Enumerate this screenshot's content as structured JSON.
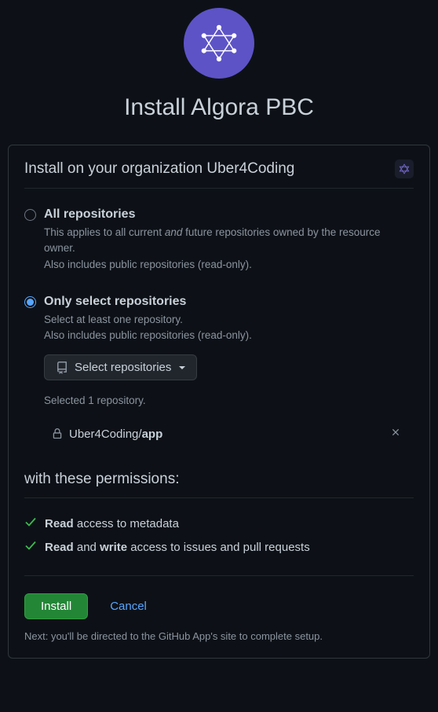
{
  "app_name": "Algora PBC",
  "page_title": "Install Algora PBC",
  "install_on": {
    "prefix": "Install on your organization ",
    "org_name": "Uber4Coding"
  },
  "repo_scope": {
    "all": {
      "label": "All repositories",
      "desc_pre": "This applies to all current ",
      "desc_em": "and",
      "desc_post": " future repositories owned by the resource owner.",
      "desc_line2": "Also includes public repositories (read-only)."
    },
    "selected": {
      "label": "Only select repositories",
      "desc_line1": "Select at least one repository.",
      "desc_line2": "Also includes public repositories (read-only)."
    },
    "active": "selected"
  },
  "select_button": "Select repositories",
  "selected_count_text": "Selected 1 repository.",
  "selected_repos": [
    {
      "owner": "Uber4Coding",
      "name": "app"
    }
  ],
  "permissions_heading": "with these permissions:",
  "permissions": [
    {
      "bold1": "Read",
      "mid": " access to metadata",
      "bold2": "",
      "tail": ""
    },
    {
      "bold1": "Read",
      "mid": " and ",
      "bold2": "write",
      "tail": " access to issues and pull requests"
    }
  ],
  "actions": {
    "install": "Install",
    "cancel": "Cancel"
  },
  "next_text": "Next: you'll be directed to the GitHub App's site to complete setup."
}
